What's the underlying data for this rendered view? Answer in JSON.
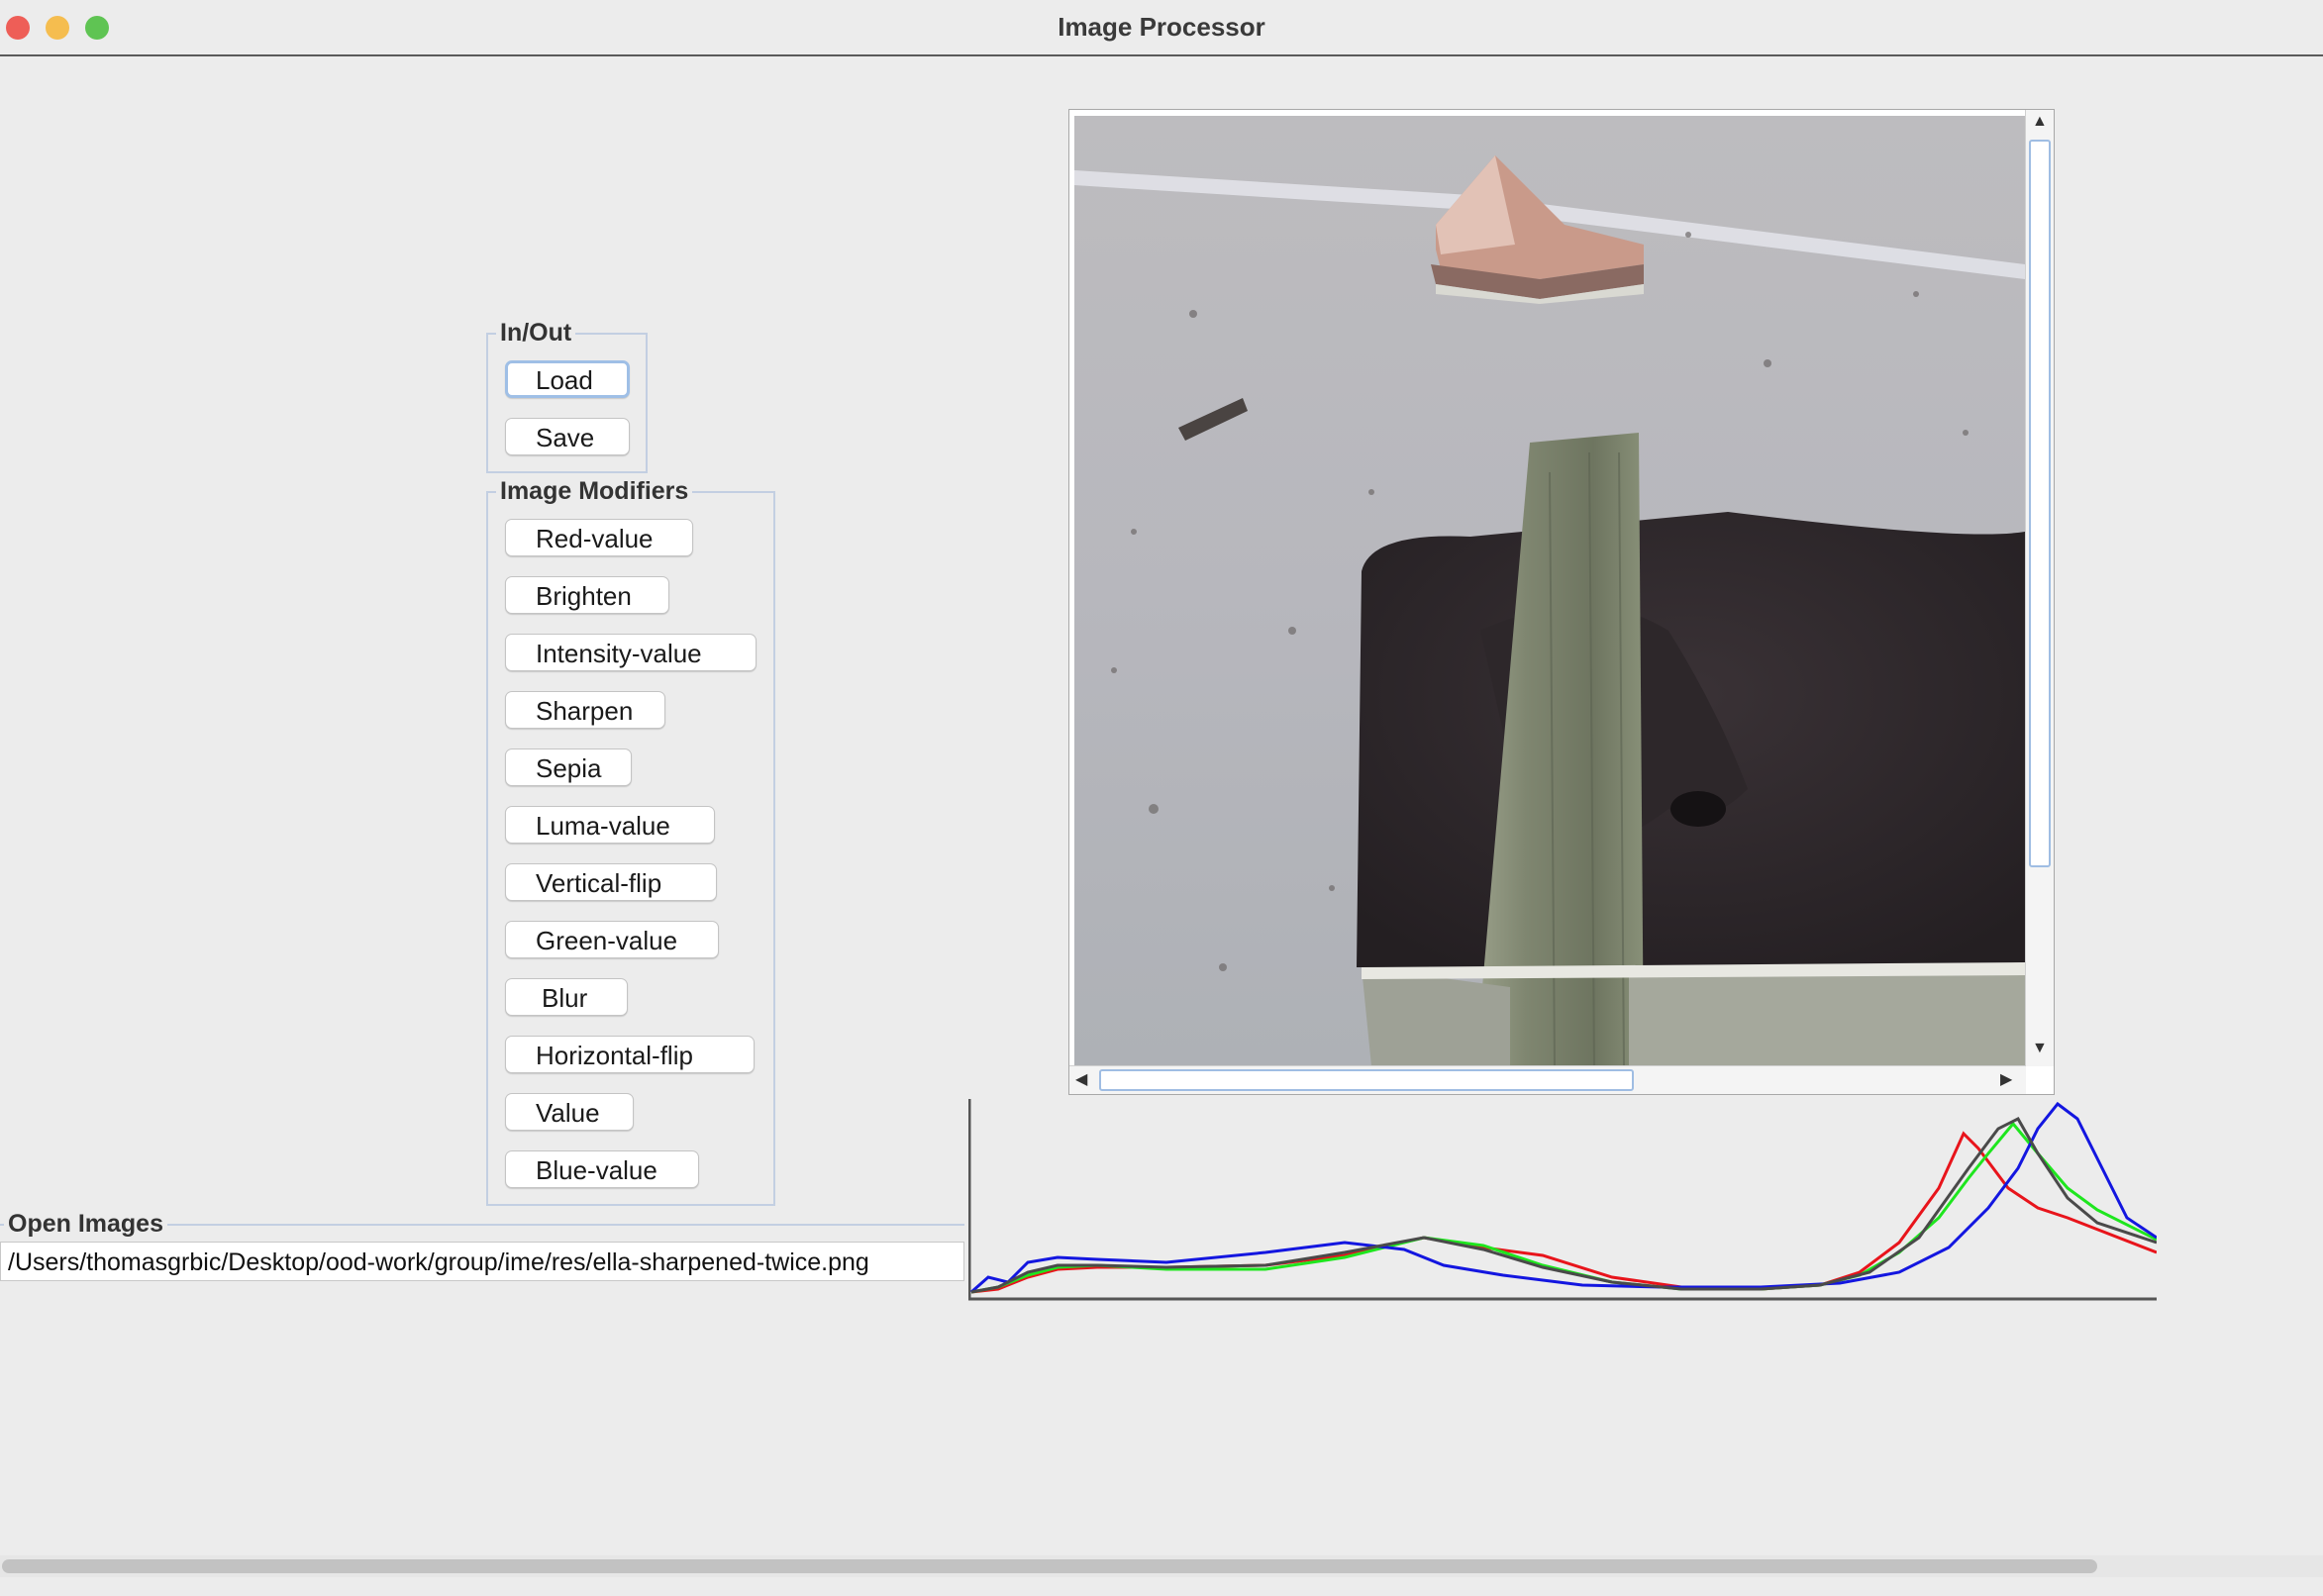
{
  "window": {
    "title": "Image Processor"
  },
  "inout": {
    "legend": "In/Out",
    "load": "Load",
    "save": "Save"
  },
  "modifiers": {
    "legend": "Image Modifiers",
    "buttons": [
      "Red-value",
      "Brighten",
      "Intensity-value",
      "Sharpen",
      "Sepia",
      "Luma-value",
      "Vertical-flip",
      "Green-value",
      "Blur",
      "Horizontal-flip",
      "Value",
      "Blue-value"
    ]
  },
  "open_images": {
    "legend": "Open Images",
    "path": "/Users/thomasgrbic/Desktop/ood-work/group/ime/res/ella-sharpened-twice.png"
  },
  "histogram": {
    "colors": {
      "red": "#e8141b",
      "green": "#1ee61e",
      "blue": "#1316e0",
      "intensity": "#4a4a4a"
    }
  },
  "colors": {
    "close": "#ee5e57",
    "minimize": "#f5bd4f",
    "maximize": "#5fc453",
    "focus_ring": "#9fbfe6"
  }
}
